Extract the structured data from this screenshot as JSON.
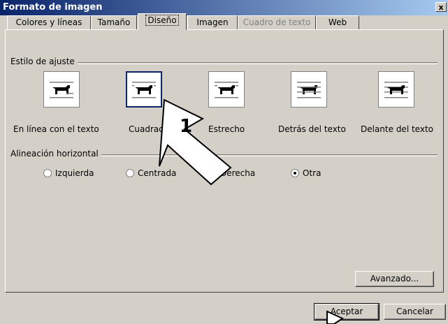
{
  "window": {
    "title": "Formato de imagen",
    "close": "x"
  },
  "tabs": [
    {
      "label": "Colores y líneas"
    },
    {
      "label": "Tamaño"
    },
    {
      "label": "Diseño"
    },
    {
      "label": "Imagen"
    },
    {
      "label": "Cuadro de texto"
    },
    {
      "label": "Web"
    }
  ],
  "wrap_style": {
    "title": "Estilo de ajuste",
    "options": [
      {
        "label": "En línea con el texto",
        "icon": "inline-dog-icon"
      },
      {
        "label": "Cuadrado",
        "icon": "square-dog-icon"
      },
      {
        "label": "Estrecho",
        "icon": "tight-dog-icon"
      },
      {
        "label": "Detrás del texto",
        "icon": "behind-dog-icon"
      },
      {
        "label": "Delante del texto",
        "icon": "front-dog-icon"
      }
    ],
    "selected": "Cuadrado"
  },
  "horizontal_align": {
    "title": "Alineación horizontal",
    "options": [
      {
        "label": "Izquierda",
        "checked": false
      },
      {
        "label": "Centrada",
        "checked": false
      },
      {
        "label": "Derecha",
        "checked": false
      },
      {
        "label": "Otra",
        "checked": true
      }
    ]
  },
  "buttons": {
    "advanced": "Avanzado...",
    "ok": "Aceptar",
    "cancel": "Cancelar"
  },
  "callout": {
    "number": "1"
  }
}
